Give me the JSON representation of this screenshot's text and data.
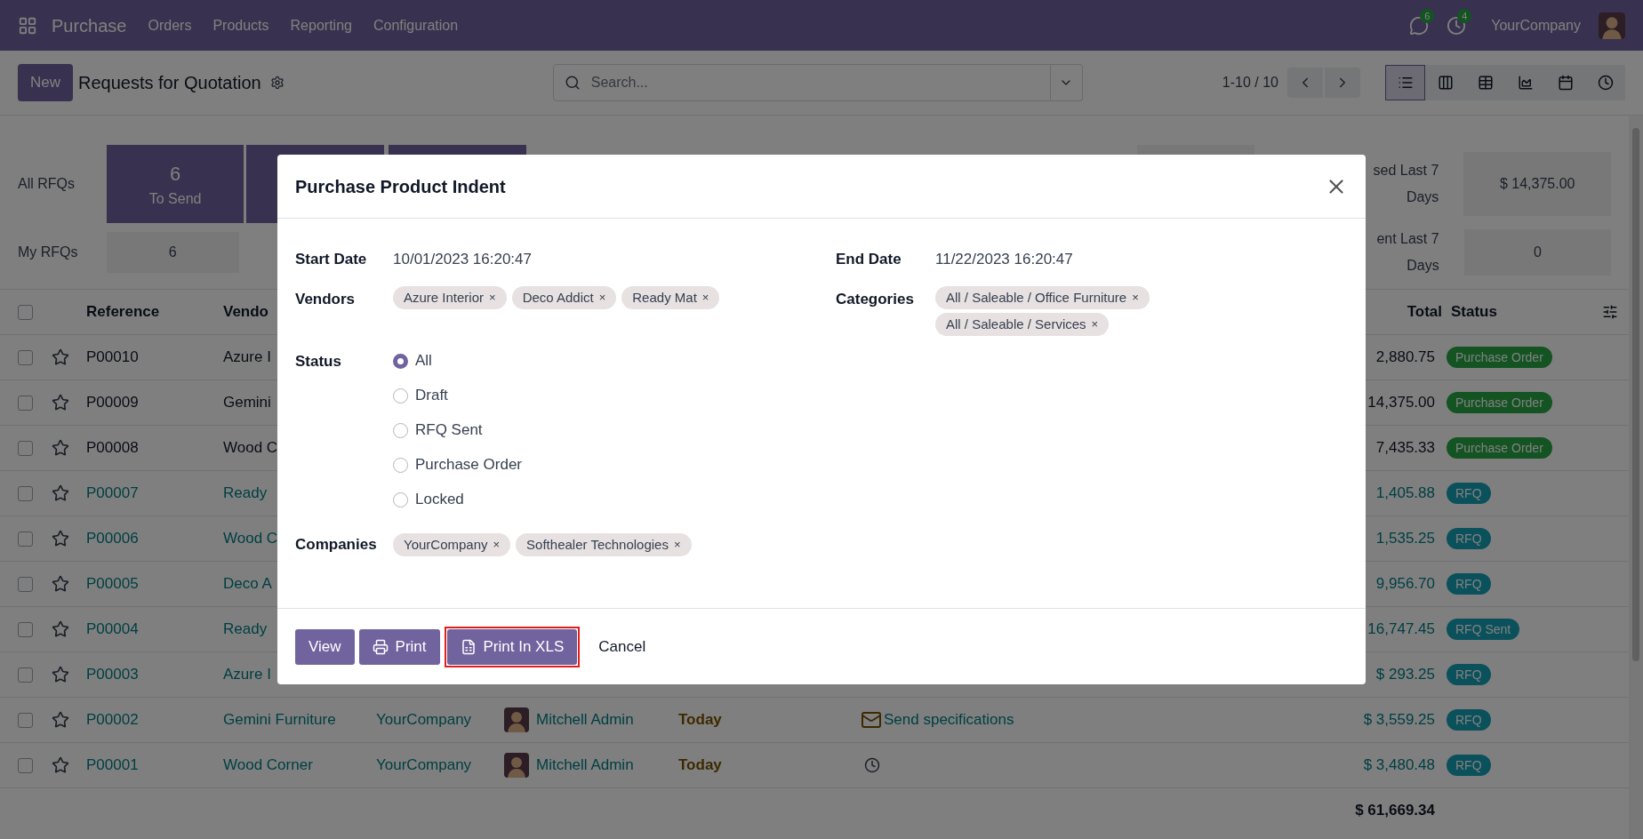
{
  "top_bar": {
    "app": "Purchase",
    "menus": [
      "Orders",
      "Products",
      "Reporting",
      "Configuration"
    ],
    "messages_badge": "6",
    "activities_badge": "4",
    "company": "YourCompany"
  },
  "control_bar": {
    "new_button": "New",
    "title": "Requests for Quotation",
    "search": {
      "placeholder": "Search..."
    },
    "pager": "1-10 / 10",
    "views": [
      {
        "kind": "list",
        "selected": true
      },
      {
        "kind": "kanban",
        "selected": false
      },
      {
        "kind": "pivot",
        "selected": false
      },
      {
        "kind": "graph",
        "selected": false
      },
      {
        "kind": "calendar",
        "selected": false
      },
      {
        "kind": "activity",
        "selected": false
      }
    ]
  },
  "dashboard": {
    "row_labels": [
      "All RFQs",
      "My RFQs"
    ],
    "to_send": {
      "value": "6",
      "label": "To Send"
    },
    "my_to_send": "6",
    "right": [
      {
        "label": "sed Last 7 Days",
        "value": "$ 14,375.00"
      },
      {
        "label": "ent Last 7 Days",
        "value": "0"
      }
    ]
  },
  "table": {
    "select_all_checked": false,
    "columns": [
      "Reference",
      "Vendo",
      "Total",
      "Status"
    ],
    "rows": [
      {
        "kind": "order",
        "checked": false,
        "reference": "P00010",
        "vendor": "Azure I",
        "total": "2,880.75",
        "status": "Purchase Order"
      },
      {
        "kind": "order",
        "checked": false,
        "reference": "P00009",
        "vendor": "Gemini",
        "total": "14,375.00",
        "status": "Purchase Order"
      },
      {
        "kind": "order",
        "checked": false,
        "reference": "P00008",
        "vendor": "Wood C",
        "total": "7,435.33",
        "status": "Purchase Order"
      },
      {
        "kind": "rfq",
        "checked": false,
        "reference": "P00007",
        "vendor": "Ready",
        "total": "1,405.88",
        "status": "RFQ"
      },
      {
        "kind": "rfq",
        "checked": false,
        "reference": "P00006",
        "vendor": "Wood C",
        "total": "1,535.25",
        "status": "RFQ"
      },
      {
        "kind": "rfq",
        "checked": false,
        "reference": "P00005",
        "vendor": "Deco A",
        "total": "9,956.70",
        "status": "RFQ"
      },
      {
        "kind": "rfq",
        "checked": false,
        "reference": "P00004",
        "vendor": "Ready",
        "total": "16,747.45",
        "status": "RFQ Sent"
      },
      {
        "kind": "rfq",
        "checked": false,
        "reference": "P00003",
        "vendor": "Azure I",
        "total": "$ 293.25",
        "status": "RFQ"
      },
      {
        "kind": "rfq",
        "checked": false,
        "reference": "P00002",
        "vendor": "Gemini Furniture",
        "company": "YourCompany",
        "buyer": "Mitchell Admin",
        "deadline": "Today",
        "activity": {
          "kind": "mail",
          "label": "Send specifications"
        },
        "total": "$ 3,559.25",
        "status": "RFQ"
      },
      {
        "kind": "rfq",
        "checked": false,
        "reference": "P00001",
        "vendor": "Wood Corner",
        "company": "YourCompany",
        "buyer": "Mitchell Admin",
        "deadline": "Today",
        "activity": {
          "kind": "clock"
        },
        "total": "$ 3,480.48",
        "status": "RFQ"
      }
    ],
    "grand_total": "$ 61,669.34"
  },
  "modal": {
    "title": "Purchase Product Indent",
    "start_date": {
      "label": "Start Date",
      "value": "10/01/2023 16:20:47"
    },
    "end_date": {
      "label": "End Date",
      "value": "11/22/2023 16:20:47"
    },
    "vendors": {
      "label": "Vendors",
      "tags": [
        "Azure Interior",
        "Deco Addict",
        "Ready Mat"
      ]
    },
    "categories": {
      "label": "Categories",
      "tags": [
        "All / Saleable / Office Furniture",
        "All / Saleable / Services"
      ]
    },
    "status": {
      "label": "Status",
      "options": [
        {
          "label": "All",
          "selected": true
        },
        {
          "label": "Draft",
          "selected": false
        },
        {
          "label": "RFQ Sent",
          "selected": false
        },
        {
          "label": "Purchase Order",
          "selected": false
        },
        {
          "label": "Locked",
          "selected": false
        }
      ]
    },
    "companies": {
      "label": "Companies",
      "tags": [
        "YourCompany",
        "Softhealer Technologies"
      ]
    },
    "buttons": [
      {
        "kind": "view",
        "label": "View",
        "highlighted": false
      },
      {
        "kind": "print",
        "label": "Print",
        "highlighted": false
      },
      {
        "kind": "xls",
        "label": "Print In XLS",
        "highlighted": true
      }
    ],
    "cancel": "Cancel",
    "tag_remove": "×"
  }
}
